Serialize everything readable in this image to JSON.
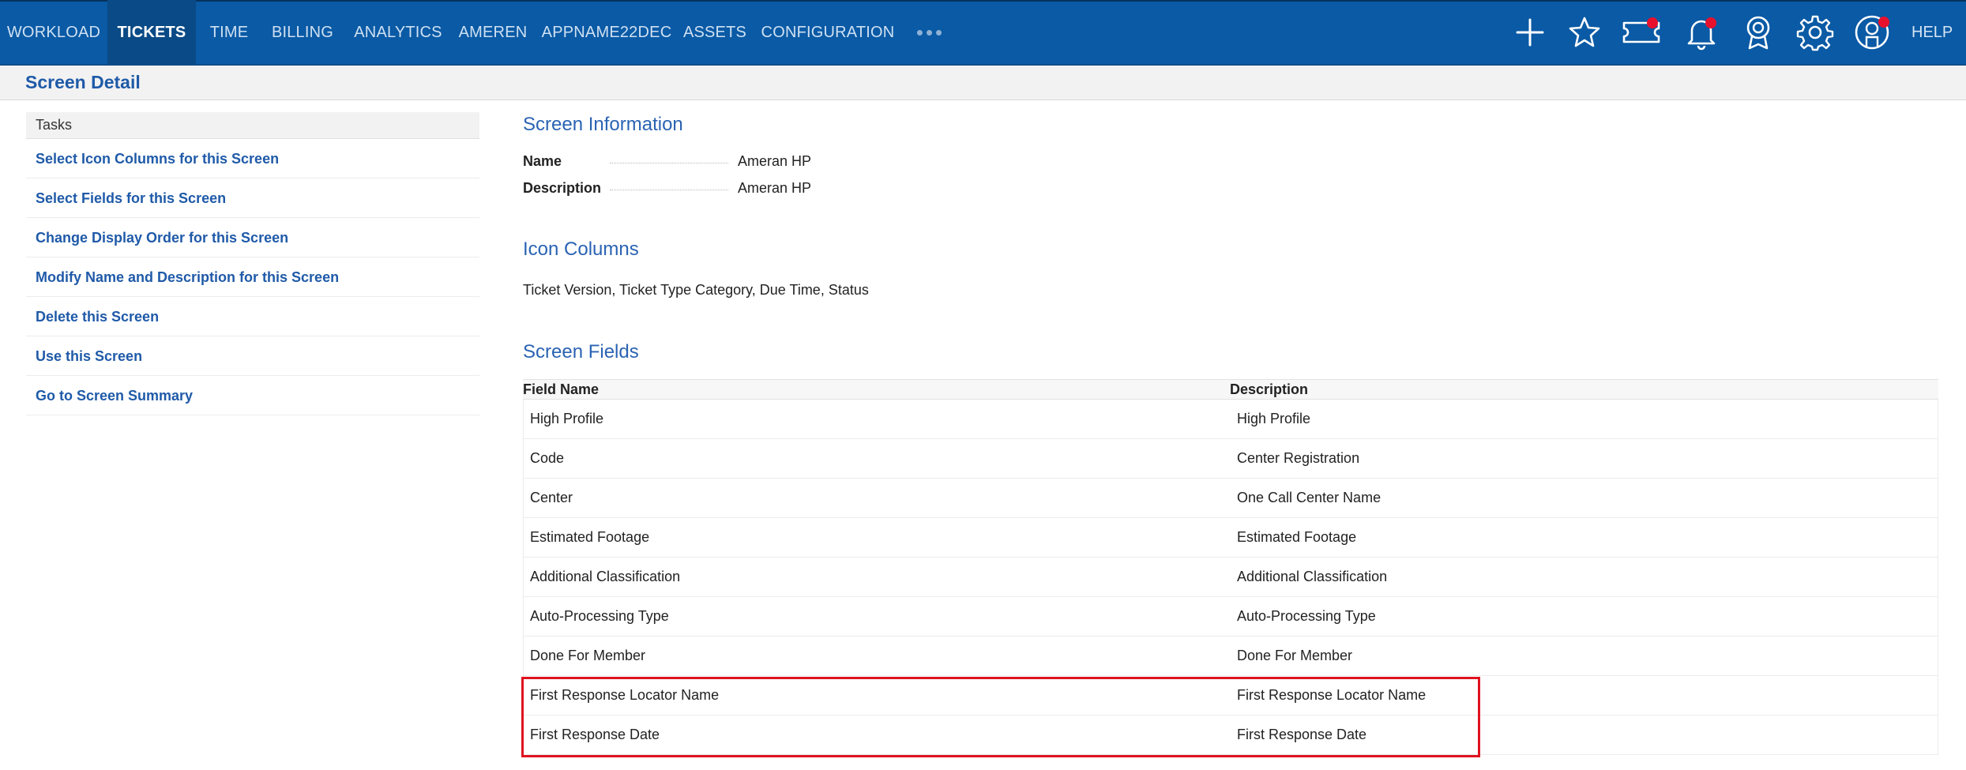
{
  "nav": {
    "items": [
      {
        "label": "WORKLOAD",
        "active": false
      },
      {
        "label": "TICKETS",
        "active": true
      },
      {
        "label": "TIME",
        "active": false
      },
      {
        "label": "BILLING",
        "active": false
      },
      {
        "label": "ANALYTICS",
        "active": false
      },
      {
        "label": "AMEREN",
        "active": false
      },
      {
        "label": "APPNAME22DEC",
        "active": false
      },
      {
        "label": "ASSETS",
        "active": false
      },
      {
        "label": "CONFIGURATION",
        "active": false
      }
    ],
    "more_label": "•••",
    "help_label": "HELP",
    "icons": [
      "plus-icon",
      "star-icon",
      "ticket-icon",
      "bell-icon",
      "award-icon",
      "gear-icon",
      "user-icon"
    ],
    "colors": {
      "bar": "#0a5aa5",
      "active": "#0a4a86",
      "badge": "#e8112d"
    }
  },
  "subheader": {
    "title": "Screen Detail"
  },
  "tasks": {
    "header": "Tasks",
    "items": [
      "Select Icon Columns for this Screen",
      "Select Fields for this Screen",
      "Change Display Order for this Screen",
      "Modify Name and Description for this Screen",
      "Delete this Screen",
      "Use this Screen",
      "Go to Screen Summary"
    ]
  },
  "screen_info": {
    "title": "Screen Information",
    "name_label": "Name",
    "name_value": "Ameran HP",
    "description_label": "Description",
    "description_value": "Ameran HP"
  },
  "icon_columns": {
    "title": "Icon Columns",
    "value": "Ticket Version, Ticket Type Category, Due Time, Status"
  },
  "screen_fields": {
    "title": "Screen Fields",
    "columns": [
      "Field Name",
      "Description"
    ],
    "rows": [
      [
        "High Profile",
        "High Profile"
      ],
      [
        "Code",
        "Center Registration"
      ],
      [
        "Center",
        "One Call Center Name"
      ],
      [
        "Estimated Footage",
        "Estimated Footage"
      ],
      [
        "Additional Classification",
        "Additional Classification"
      ],
      [
        "Auto-Processing Type",
        "Auto-Processing Type"
      ],
      [
        "Done For Member",
        "Done For Member"
      ],
      [
        "First Response Locator Name",
        "First Response Locator Name"
      ],
      [
        "First Response Date",
        "First Response Date"
      ]
    ]
  }
}
